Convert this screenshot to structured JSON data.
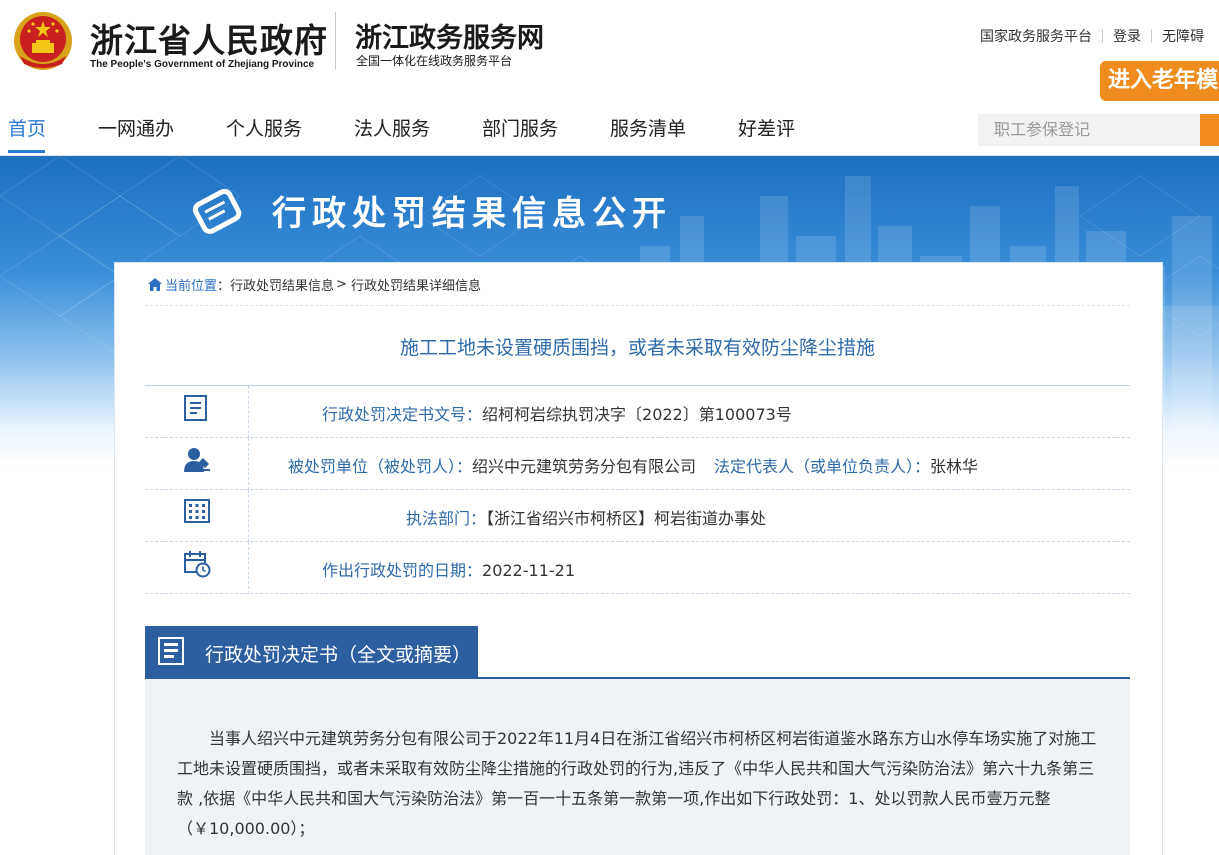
{
  "header": {
    "gov_title": "浙江省人民政府",
    "gov_subtitle": "The People's Government of Zhejiang Province",
    "service_title": "浙江政务服务网",
    "service_subtitle": "全国一体化在线政务服务平台",
    "links": [
      "国家政务服务平台",
      "登录",
      "无障碍"
    ],
    "elder_button": "进入老年模式",
    "accent_color": "#f08c1d"
  },
  "nav": {
    "items": [
      "首页",
      "一网通办",
      "个人服务",
      "法人服务",
      "部门服务",
      "服务清单",
      "好差评"
    ],
    "active_index": 0,
    "search_placeholder": "职工参保登记",
    "active_color": "#2a7bd1"
  },
  "banner": {
    "title": "行政处罚结果信息公开"
  },
  "breadcrumb": {
    "home": "当前位置",
    "sep1": "：",
    "level1": "行政处罚结果信息",
    "sep2": ">",
    "level2": "行政处罚结果详细信息"
  },
  "document": {
    "title": "施工工地未设置硬质围挡，或者未采取有效防尘降尘措施",
    "rows": [
      {
        "icon": "document-icon",
        "label": "行政处罚决定书文号：",
        "value": "绍柯柯岩综执罚决字〔2022〕第100073号"
      },
      {
        "icon": "person-icon",
        "label": "被处罚单位（被处罚人）：",
        "value": "绍兴中元建筑劳务分包有限公司",
        "label2": "法定代表人（或单位负责人）：",
        "value2": "张林华"
      },
      {
        "icon": "building-icon",
        "label": "执法部门：",
        "value": "【浙江省绍兴市柯桥区】柯岩街道办事处"
      },
      {
        "icon": "calendar-clock-icon",
        "label": "作出行政处罚的日期：",
        "value": "2022-11-21"
      }
    ]
  },
  "decision": {
    "heading": "行政处罚决定书（全文或摘要）",
    "text": "当事人绍兴中元建筑劳务分包有限公司于2022年11月4日在浙江省绍兴市柯桥区柯岩街道鉴水路东方山水停车场实施了对施工工地未设置硬质围挡，或者未采取有效防尘降尘措施的行政处罚的行为,违反了《中华人民共和国大气污染防治法》第六十九条第三款 ,依据《中华人民共和国大气污染防治法》第一百一十五条第一款第一项,作出如下行政处罚：1、处以罚款人民币壹万元整（￥10,000.00）；"
  }
}
